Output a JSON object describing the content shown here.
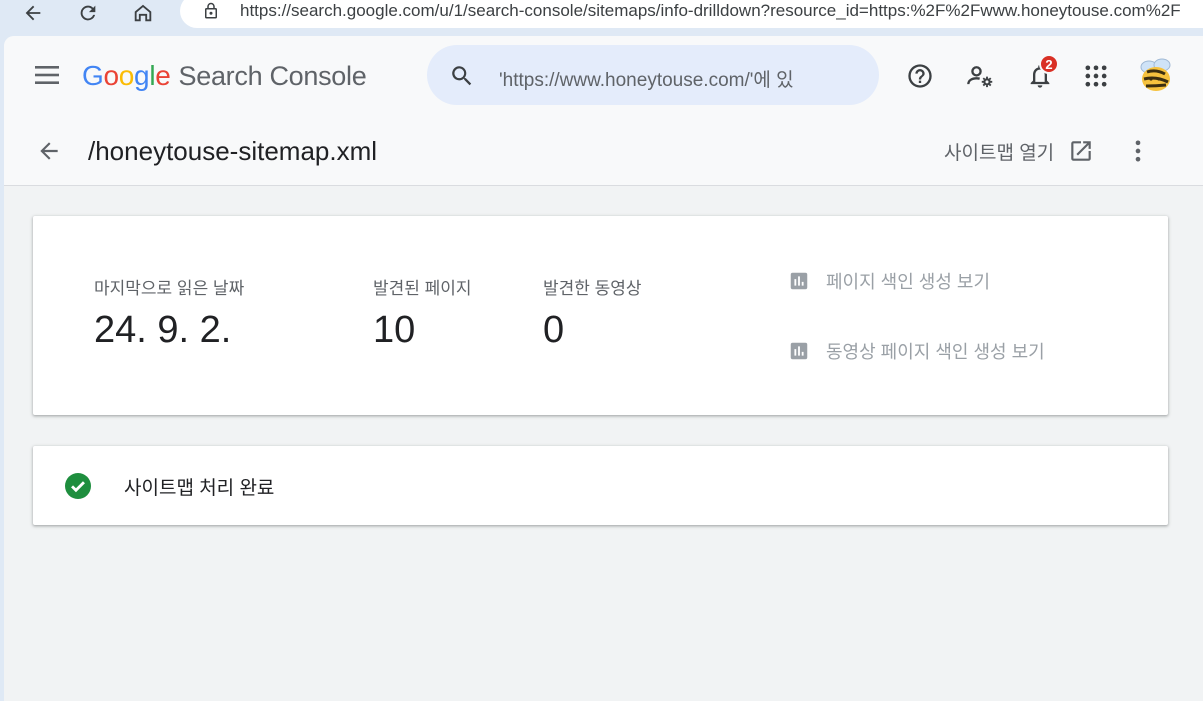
{
  "browser": {
    "url": "https://search.google.com/u/1/search-console/sitemaps/info-drilldown?resource_id=https:%2F%2Fwww.honeytouse.com%2F"
  },
  "app": {
    "logo_letters": [
      "G",
      "o",
      "o",
      "g",
      "l",
      "e"
    ],
    "product_name": "Search Console",
    "search_value": "'https://www.honeytouse.com/'에 있",
    "notification_count": "2"
  },
  "header": {
    "title": "/honeytouse-sitemap.xml",
    "open_sitemap_label": "사이트맵 열기"
  },
  "stats": [
    {
      "label": "마지막으로 읽은 날짜",
      "value": "24. 9. 2."
    },
    {
      "label": "발견된 페이지",
      "value": "10"
    },
    {
      "label": "발견한 동영상",
      "value": "0"
    }
  ],
  "reports": {
    "page_indexing": "페이지 색인 생성 보기",
    "video_indexing": "동영상 페이지 색인 생성 보기"
  },
  "status": {
    "text": "사이트맵 처리 완료",
    "color": "#1e8e3e"
  },
  "icons": {
    "back": "back-arrow-icon",
    "reload": "reload-icon",
    "home": "home-icon",
    "lock": "lock-icon",
    "menu": "menu-icon",
    "search": "search-icon",
    "help": "help-icon",
    "user_settings": "manage-users-icon",
    "notifications": "bell-icon",
    "apps": "apps-grid-icon",
    "open_external": "open-in-new-icon",
    "more": "more-vert-icon",
    "bar_chart": "bar-chart-icon",
    "check": "check-circle-icon"
  }
}
